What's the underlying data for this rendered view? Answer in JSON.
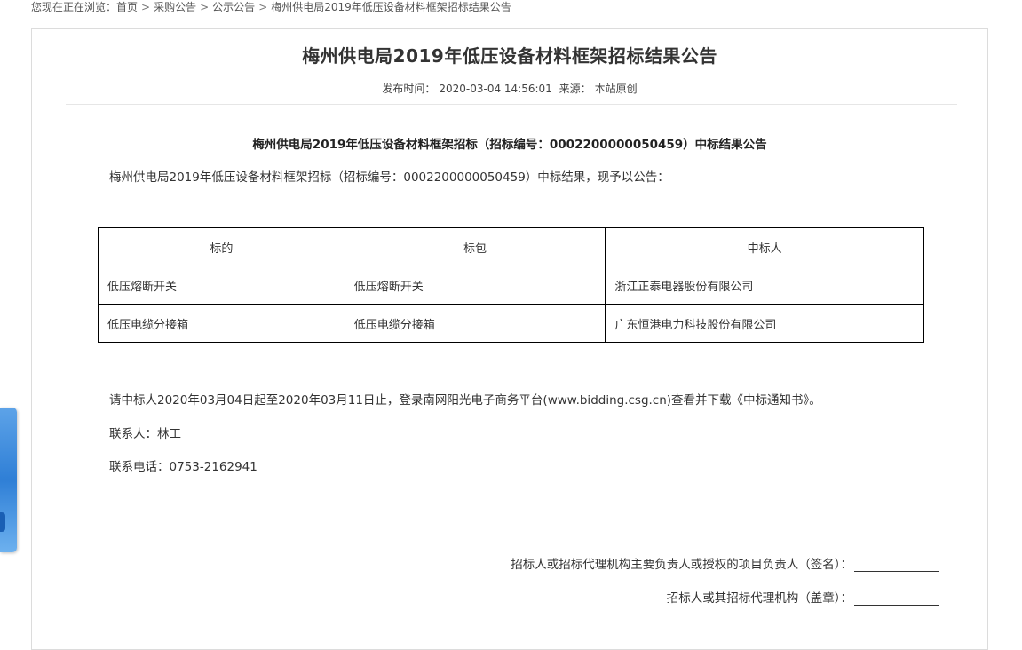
{
  "breadcrumb": {
    "prefix": "您现在正在浏览：",
    "items": [
      "首页",
      "采购公告",
      "公示公告",
      "梅州供电局2019年低压设备材料框架招标结果公告"
    ],
    "separator": ">"
  },
  "article": {
    "title": "梅州供电局2019年低压设备材料框架招标结果公告",
    "publish_label": "发布时间：",
    "publish_time": "2020-03-04 14:56:01",
    "source_label": "来源：",
    "source": "本站原创",
    "subheading": "梅州供电局2019年低压设备材料框架招标（招标编号：0002200000050459）中标结果公告",
    "intro": "梅州供电局2019年低压设备材料框架招标（招标编号：0002200000050459）中标结果，现予以公告："
  },
  "table": {
    "headers": [
      "标的",
      "标包",
      "中标人"
    ],
    "rows": [
      [
        "低压熔断开关",
        "低压熔断开关",
        "浙江正泰电器股份有限公司"
      ],
      [
        "低压电缆分接箱",
        "低压电缆分接箱",
        "广东恒港电力科技股份有限公司"
      ]
    ]
  },
  "notice": {
    "download": "请中标人2020年03月04日起至2020年03月11日止，登录南网阳光电子商务平台(www.bidding.csg.cn)查看并下载《中标通知书》。",
    "contact": "联系人：林工",
    "phone": "联系电话：0753-2162941"
  },
  "signature": {
    "line1": "招标人或招标代理机构主要负责人或授权的项目负责人（签名）：",
    "line2": "招标人或其招标代理机构（盖章）："
  },
  "colors": {
    "sidebar_tab": "#2f7fd6",
    "table_border": "#000000"
  }
}
